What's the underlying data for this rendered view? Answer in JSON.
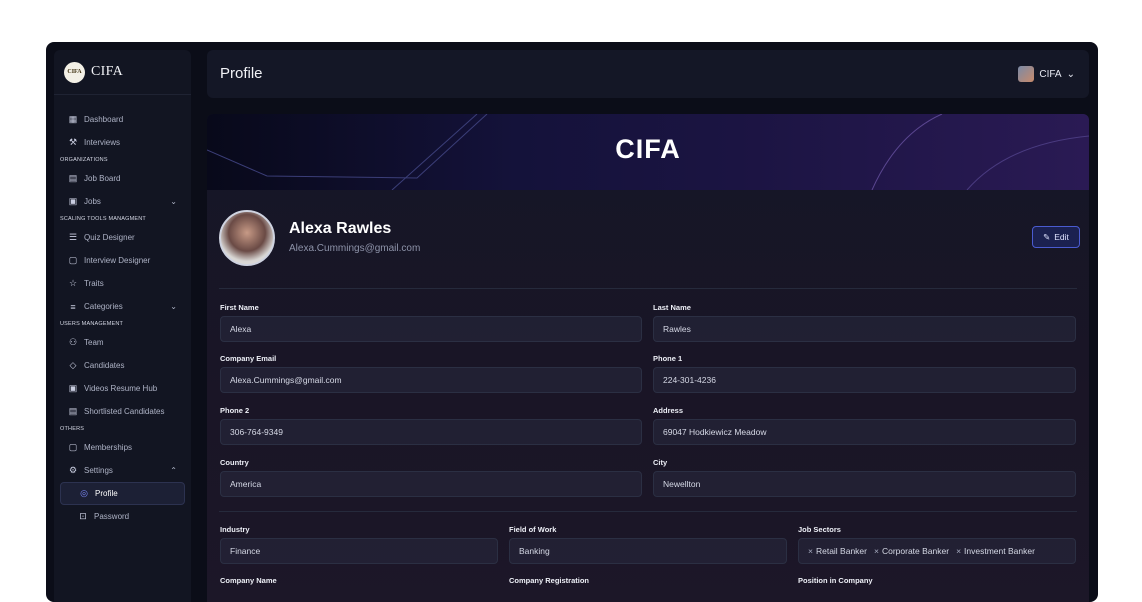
{
  "app": {
    "brand": "CIFA",
    "logo_text": "CIFA"
  },
  "sidebar": {
    "items": [
      {
        "type": "item",
        "icon": "dashboard-icon",
        "glyph": "▦",
        "label": "Dashboard"
      },
      {
        "type": "item",
        "icon": "gavel-icon",
        "glyph": "⚒",
        "label": "Interviews"
      },
      {
        "type": "section",
        "label": "ORGANIZATIONS"
      },
      {
        "type": "item",
        "icon": "board-icon",
        "glyph": "▤",
        "label": "Job Board"
      },
      {
        "type": "item",
        "icon": "briefcase-icon",
        "glyph": "▣",
        "label": "Jobs",
        "chevron": "⌄"
      },
      {
        "type": "section",
        "label": "SCALING TOOLS MANAGMENT"
      },
      {
        "type": "item",
        "icon": "quiz-icon",
        "glyph": "☰",
        "label": "Quiz Designer"
      },
      {
        "type": "item",
        "icon": "interview-designer-icon",
        "glyph": "▢",
        "label": "Interview Designer"
      },
      {
        "type": "item",
        "icon": "star-icon",
        "glyph": "☆",
        "label": "Traits"
      },
      {
        "type": "item",
        "icon": "list-icon",
        "glyph": "≡",
        "label": "Categories",
        "chevron": "⌄"
      },
      {
        "type": "section",
        "label": "USERS MANAGEMENT"
      },
      {
        "type": "item",
        "icon": "team-icon",
        "glyph": "⚇",
        "label": "Team"
      },
      {
        "type": "item",
        "icon": "graduation-cap-icon",
        "glyph": "◇",
        "label": "Candidates"
      },
      {
        "type": "item",
        "icon": "video-icon",
        "glyph": "▣",
        "label": "Videos Resume Hub"
      },
      {
        "type": "item",
        "icon": "clipboard-icon",
        "glyph": "▤",
        "label": "Shortlisted Candidates"
      },
      {
        "type": "section",
        "label": "OTHERS"
      },
      {
        "type": "item",
        "icon": "membership-icon",
        "glyph": "▢",
        "label": "Memberships"
      },
      {
        "type": "item",
        "icon": "gear-icon",
        "glyph": "⚙",
        "label": "Settings",
        "chevron": "⌃"
      },
      {
        "type": "sub",
        "icon": "profile-icon",
        "glyph": "◎",
        "label": "Profile",
        "active": true
      },
      {
        "type": "sub",
        "icon": "lock-icon",
        "glyph": "⊡",
        "label": "Password"
      }
    ]
  },
  "header": {
    "title": "Profile",
    "user_label": "CIFA",
    "chevron": "⌄"
  },
  "banner": {
    "title": "CIFA"
  },
  "profile": {
    "name": "Alexa Rawles",
    "email": "Alexa.Cummings@gmail.com",
    "edit_label": "Edit",
    "edit_icon": "✎"
  },
  "form": {
    "first_name": {
      "label": "First Name",
      "value": "Alexa"
    },
    "last_name": {
      "label": "Last Name",
      "value": "Rawles"
    },
    "company_email": {
      "label": "Company Email",
      "value": "Alexa.Cummings@gmail.com"
    },
    "phone1": {
      "label": "Phone 1",
      "value": "224-301-4236"
    },
    "phone2": {
      "label": "Phone 2",
      "value": "306-764-9349"
    },
    "address": {
      "label": "Address",
      "value": "69047 Hodkiewicz Meadow"
    },
    "country": {
      "label": "Country",
      "value": "America"
    },
    "city": {
      "label": "City",
      "value": "Newellton"
    },
    "industry": {
      "label": "Industry",
      "value": "Finance"
    },
    "field_of_work": {
      "label": "Field of Work",
      "value": "Banking"
    },
    "job_sectors": {
      "label": "Job Sectors",
      "tags": [
        "Retail Banker",
        "Corporate Banker",
        "Investment Banker"
      ],
      "remove_glyph": "×"
    },
    "company_name": {
      "label": "Company Name"
    },
    "company_registration": {
      "label": "Company Registration"
    },
    "position": {
      "label": "Position in Company"
    }
  }
}
